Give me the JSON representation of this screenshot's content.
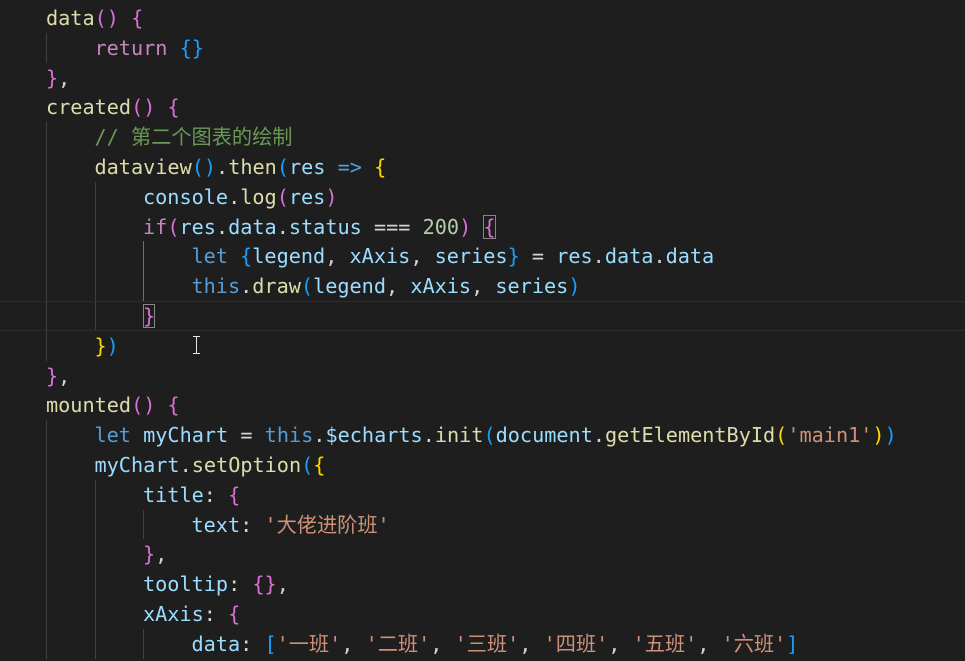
{
  "editor": {
    "language": "javascript",
    "theme_background": "#1e1e1e",
    "current_line_index": 10,
    "lines": [
      [
        [
          "data",
          "fn"
        ],
        [
          "(",
          "b2"
        ],
        [
          ")",
          "b2"
        ],
        [
          " ",
          "pu"
        ],
        [
          "{",
          "b2"
        ]
      ],
      [
        [
          "return",
          "kw"
        ],
        [
          " ",
          "pu"
        ],
        [
          "{",
          "b3"
        ],
        [
          "}",
          "b3"
        ]
      ],
      [
        [
          "}",
          "b2"
        ],
        [
          ",",
          "pu"
        ]
      ],
      [
        [
          "created",
          "fn"
        ],
        [
          "(",
          "b2"
        ],
        [
          ")",
          "b2"
        ],
        [
          " ",
          "pu"
        ],
        [
          "{",
          "b2"
        ]
      ],
      [
        [
          "// 第二个图表的绘制",
          "cm"
        ]
      ],
      [
        [
          "dataview",
          "fn"
        ],
        [
          "(",
          "b3"
        ],
        [
          ")",
          "b3"
        ],
        [
          ".",
          "pu"
        ],
        [
          "then",
          "fn"
        ],
        [
          "(",
          "b3"
        ],
        [
          "res",
          "vr"
        ],
        [
          " ",
          "pu"
        ],
        [
          "=>",
          "st"
        ],
        [
          " ",
          "pu"
        ],
        [
          "{",
          "b1"
        ]
      ],
      [
        [
          "console",
          "vr"
        ],
        [
          ".",
          "pu"
        ],
        [
          "log",
          "fn"
        ],
        [
          "(",
          "b2"
        ],
        [
          "res",
          "vr"
        ],
        [
          ")",
          "b2"
        ]
      ],
      [
        [
          "if",
          "kw"
        ],
        [
          "(",
          "b2"
        ],
        [
          "res",
          "vr"
        ],
        [
          ".",
          "pu"
        ],
        [
          "data",
          "vr"
        ],
        [
          ".",
          "pu"
        ],
        [
          "status",
          "vr"
        ],
        [
          " === ",
          "pu"
        ],
        [
          "200",
          "nm"
        ],
        [
          ")",
          "b2"
        ],
        [
          " ",
          "pu"
        ],
        [
          "{",
          "b2bm"
        ]
      ],
      [
        [
          "let",
          "st"
        ],
        [
          " ",
          "pu"
        ],
        [
          "{",
          "b3"
        ],
        [
          "legend",
          "vr"
        ],
        [
          ", ",
          "pu"
        ],
        [
          "xAxis",
          "vr"
        ],
        [
          ", ",
          "pu"
        ],
        [
          "series",
          "vr"
        ],
        [
          "}",
          "b3"
        ],
        [
          " = ",
          "pu"
        ],
        [
          "res",
          "vr"
        ],
        [
          ".",
          "pu"
        ],
        [
          "data",
          "vr"
        ],
        [
          ".",
          "pu"
        ],
        [
          "data",
          "vr"
        ]
      ],
      [
        [
          "this",
          "st"
        ],
        [
          ".",
          "pu"
        ],
        [
          "draw",
          "fn"
        ],
        [
          "(",
          "b3"
        ],
        [
          "legend",
          "vr"
        ],
        [
          ", ",
          "pu"
        ],
        [
          "xAxis",
          "vr"
        ],
        [
          ", ",
          "pu"
        ],
        [
          "series",
          "vr"
        ],
        [
          ")",
          "b3"
        ]
      ],
      [
        [
          "}",
          "b2bm"
        ]
      ],
      [
        [
          "}",
          "b1"
        ],
        [
          ")",
          "b3"
        ]
      ],
      [
        [
          "}",
          "b2"
        ],
        [
          ",",
          "pu"
        ]
      ],
      [
        [
          "mounted",
          "fn"
        ],
        [
          "(",
          "b2"
        ],
        [
          ")",
          "b2"
        ],
        [
          " ",
          "pu"
        ],
        [
          "{",
          "b2"
        ]
      ],
      [
        [
          "let",
          "st"
        ],
        [
          " ",
          "pu"
        ],
        [
          "myChart",
          "vr"
        ],
        [
          " = ",
          "pu"
        ],
        [
          "this",
          "st"
        ],
        [
          ".",
          "pu"
        ],
        [
          "$echarts",
          "vr"
        ],
        [
          ".",
          "pu"
        ],
        [
          "init",
          "fn"
        ],
        [
          "(",
          "b3"
        ],
        [
          "document",
          "vr"
        ],
        [
          ".",
          "pu"
        ],
        [
          "getElementById",
          "fn"
        ],
        [
          "(",
          "b1"
        ],
        [
          "'main1'",
          "str"
        ],
        [
          ")",
          "b1"
        ],
        [
          ")",
          "b3"
        ]
      ],
      [
        [
          "myChart",
          "vr"
        ],
        [
          ".",
          "pu"
        ],
        [
          "setOption",
          "fn"
        ],
        [
          "(",
          "b3"
        ],
        [
          "{",
          "b1"
        ]
      ],
      [
        [
          "title",
          "vr"
        ],
        [
          ": ",
          "pu"
        ],
        [
          "{",
          "b2"
        ]
      ],
      [
        [
          "text",
          "vr"
        ],
        [
          ": ",
          "pu"
        ],
        [
          "'大佬进阶班'",
          "str"
        ]
      ],
      [
        [
          "}",
          "b2"
        ],
        [
          ",",
          "pu"
        ]
      ],
      [
        [
          "tooltip",
          "vr"
        ],
        [
          ": ",
          "pu"
        ],
        [
          "{",
          "b2"
        ],
        [
          "}",
          "b2"
        ],
        [
          ",",
          "pu"
        ]
      ],
      [
        [
          "xAxis",
          "vr"
        ],
        [
          ": ",
          "pu"
        ],
        [
          "{",
          "b2"
        ]
      ],
      [
        [
          "data",
          "vr"
        ],
        [
          ": ",
          "pu"
        ],
        [
          "[",
          "b3"
        ],
        [
          "'一班'",
          "str"
        ],
        [
          ", ",
          "pu"
        ],
        [
          "'二班'",
          "str"
        ],
        [
          ", ",
          "pu"
        ],
        [
          "'三班'",
          "str"
        ],
        [
          ", ",
          "pu"
        ],
        [
          "'四班'",
          "str"
        ],
        [
          ", ",
          "pu"
        ],
        [
          "'五班'",
          "str"
        ],
        [
          ", ",
          "pu"
        ],
        [
          "'六班'",
          "str"
        ],
        [
          "]",
          "b3"
        ]
      ]
    ],
    "indents": [
      1,
      2,
      1,
      1,
      2,
      2,
      3,
      3,
      4,
      4,
      3,
      2,
      1,
      1,
      2,
      2,
      3,
      4,
      3,
      3,
      3,
      4
    ]
  }
}
